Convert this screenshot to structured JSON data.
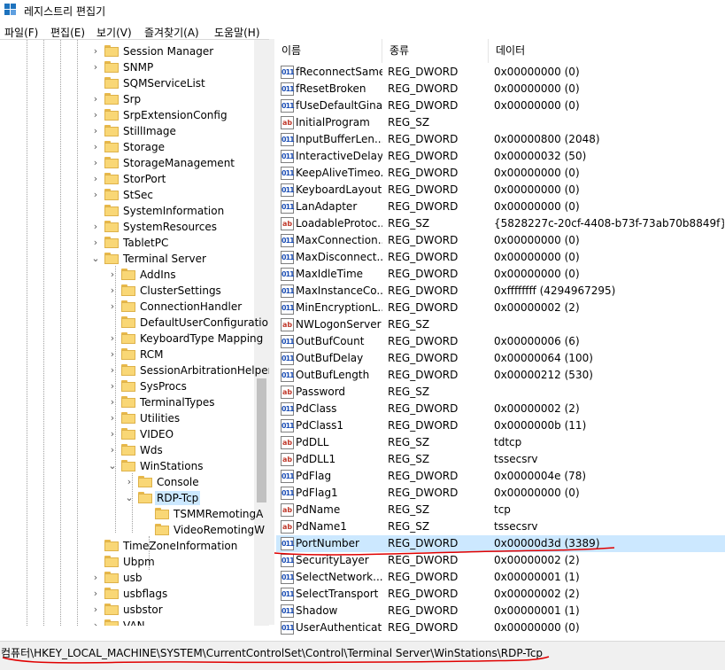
{
  "window": {
    "title": "레지스트리 편집기"
  },
  "menu": [
    {
      "label": "파일(F)",
      "name": "menu-file"
    },
    {
      "label": "편집(E)",
      "name": "menu-edit"
    },
    {
      "label": "보기(V)",
      "name": "menu-view"
    },
    {
      "label": "즐겨찾기(A)",
      "name": "menu-favorites"
    },
    {
      "label": "도움말(H)",
      "name": "menu-help"
    }
  ],
  "tree": [
    {
      "label": "Session Manager",
      "level": 0,
      "state": "collapsed"
    },
    {
      "label": "SNMP",
      "level": 0,
      "state": "collapsed"
    },
    {
      "label": "SQMServiceList",
      "level": 0,
      "state": "none"
    },
    {
      "label": "Srp",
      "level": 0,
      "state": "collapsed"
    },
    {
      "label": "SrpExtensionConfig",
      "level": 0,
      "state": "collapsed"
    },
    {
      "label": "StillImage",
      "level": 0,
      "state": "collapsed"
    },
    {
      "label": "Storage",
      "level": 0,
      "state": "collapsed"
    },
    {
      "label": "StorageManagement",
      "level": 0,
      "state": "collapsed"
    },
    {
      "label": "StorPort",
      "level": 0,
      "state": "collapsed"
    },
    {
      "label": "StSec",
      "level": 0,
      "state": "collapsed"
    },
    {
      "label": "SystemInformation",
      "level": 0,
      "state": "none"
    },
    {
      "label": "SystemResources",
      "level": 0,
      "state": "collapsed"
    },
    {
      "label": "TabletPC",
      "level": 0,
      "state": "collapsed"
    },
    {
      "label": "Terminal Server",
      "level": 0,
      "state": "expanded"
    },
    {
      "label": "AddIns",
      "level": 1,
      "state": "collapsed"
    },
    {
      "label": "ClusterSettings",
      "level": 1,
      "state": "collapsed"
    },
    {
      "label": "ConnectionHandler",
      "level": 1,
      "state": "collapsed"
    },
    {
      "label": "DefaultUserConfiguratio",
      "level": 1,
      "state": "none"
    },
    {
      "label": "KeyboardType Mapping",
      "level": 1,
      "state": "collapsed"
    },
    {
      "label": "RCM",
      "level": 1,
      "state": "collapsed"
    },
    {
      "label": "SessionArbitrationHelper",
      "level": 1,
      "state": "collapsed"
    },
    {
      "label": "SysProcs",
      "level": 1,
      "state": "collapsed"
    },
    {
      "label": "TerminalTypes",
      "level": 1,
      "state": "collapsed"
    },
    {
      "label": "Utilities",
      "level": 1,
      "state": "collapsed"
    },
    {
      "label": "VIDEO",
      "level": 1,
      "state": "collapsed"
    },
    {
      "label": "Wds",
      "level": 1,
      "state": "collapsed"
    },
    {
      "label": "WinStations",
      "level": 1,
      "state": "expanded"
    },
    {
      "label": "Console",
      "level": 2,
      "state": "collapsed"
    },
    {
      "label": "RDP-Tcp",
      "level": 2,
      "state": "expanded",
      "selected": true
    },
    {
      "label": "TSMMRemotingA",
      "level": 3,
      "state": "none"
    },
    {
      "label": "VideoRemotingW",
      "level": 3,
      "state": "none"
    },
    {
      "label": "TimeZoneInformation",
      "level": 0,
      "state": "none"
    },
    {
      "label": "Ubpm",
      "level": 0,
      "state": "none"
    },
    {
      "label": "usb",
      "level": 0,
      "state": "collapsed"
    },
    {
      "label": "usbflags",
      "level": 0,
      "state": "collapsed"
    },
    {
      "label": "usbstor",
      "level": 0,
      "state": "collapsed"
    },
    {
      "label": "VAN",
      "level": 0,
      "state": "collapsed"
    }
  ],
  "columns": {
    "name": "이름",
    "type": "종류",
    "data": "데이터"
  },
  "values": [
    {
      "name": "fReconnectSame",
      "type": "REG_DWORD",
      "data": "0x00000000 (0)"
    },
    {
      "name": "fResetBroken",
      "type": "REG_DWORD",
      "data": "0x00000000 (0)"
    },
    {
      "name": "fUseDefaultGina",
      "type": "REG_DWORD",
      "data": "0x00000000 (0)"
    },
    {
      "name": "InitialProgram",
      "type": "REG_SZ",
      "data": ""
    },
    {
      "name": "InputBufferLen...",
      "type": "REG_DWORD",
      "data": "0x00000800 (2048)"
    },
    {
      "name": "InteractiveDelay",
      "type": "REG_DWORD",
      "data": "0x00000032 (50)"
    },
    {
      "name": "KeepAliveTimeo...",
      "type": "REG_DWORD",
      "data": "0x00000000 (0)"
    },
    {
      "name": "KeyboardLayout",
      "type": "REG_DWORD",
      "data": "0x00000000 (0)"
    },
    {
      "name": "LanAdapter",
      "type": "REG_DWORD",
      "data": "0x00000000 (0)"
    },
    {
      "name": "LoadableProtoc...",
      "type": "REG_SZ",
      "data": "{5828227c-20cf-4408-b73f-73ab70b8849f}"
    },
    {
      "name": "MaxConnection...",
      "type": "REG_DWORD",
      "data": "0x00000000 (0)"
    },
    {
      "name": "MaxDisconnect...",
      "type": "REG_DWORD",
      "data": "0x00000000 (0)"
    },
    {
      "name": "MaxIdleTime",
      "type": "REG_DWORD",
      "data": "0x00000000 (0)"
    },
    {
      "name": "MaxInstanceCo...",
      "type": "REG_DWORD",
      "data": "0xffffffff (4294967295)"
    },
    {
      "name": "MinEncryptionL...",
      "type": "REG_DWORD",
      "data": "0x00000002 (2)"
    },
    {
      "name": "NWLogonServer",
      "type": "REG_SZ",
      "data": ""
    },
    {
      "name": "OutBufCount",
      "type": "REG_DWORD",
      "data": "0x00000006 (6)"
    },
    {
      "name": "OutBufDelay",
      "type": "REG_DWORD",
      "data": "0x00000064 (100)"
    },
    {
      "name": "OutBufLength",
      "type": "REG_DWORD",
      "data": "0x00000212 (530)"
    },
    {
      "name": "Password",
      "type": "REG_SZ",
      "data": ""
    },
    {
      "name": "PdClass",
      "type": "REG_DWORD",
      "data": "0x00000002 (2)"
    },
    {
      "name": "PdClass1",
      "type": "REG_DWORD",
      "data": "0x0000000b (11)"
    },
    {
      "name": "PdDLL",
      "type": "REG_SZ",
      "data": "tdtcp"
    },
    {
      "name": "PdDLL1",
      "type": "REG_SZ",
      "data": "tssecsrv"
    },
    {
      "name": "PdFlag",
      "type": "REG_DWORD",
      "data": "0x0000004e (78)"
    },
    {
      "name": "PdFlag1",
      "type": "REG_DWORD",
      "data": "0x00000000 (0)"
    },
    {
      "name": "PdName",
      "type": "REG_SZ",
      "data": "tcp"
    },
    {
      "name": "PdName1",
      "type": "REG_SZ",
      "data": "tssecsrv"
    },
    {
      "name": "PortNumber",
      "type": "REG_DWORD",
      "data": "0x00000d3d (3389)",
      "selected": true
    },
    {
      "name": "SecurityLayer",
      "type": "REG_DWORD",
      "data": "0x00000002 (2)"
    },
    {
      "name": "SelectNetwork...",
      "type": "REG_DWORD",
      "data": "0x00000001 (1)"
    },
    {
      "name": "SelectTransport",
      "type": "REG_DWORD",
      "data": "0x00000002 (2)"
    },
    {
      "name": "Shadow",
      "type": "REG_DWORD",
      "data": "0x00000001 (1)"
    },
    {
      "name": "UserAuthenticat...",
      "type": "REG_DWORD",
      "data": "0x00000000 (0)"
    }
  ],
  "statusbar": {
    "path": "컴퓨터\\HKEY_LOCAL_MACHINE\\SYSTEM\\CurrentControlSet\\Control\\Terminal Server\\WinStations\\RDP-Tcp"
  },
  "colors": {
    "selection": "#cce8ff",
    "annotation": "#e00000",
    "folder": "#f9d776"
  }
}
